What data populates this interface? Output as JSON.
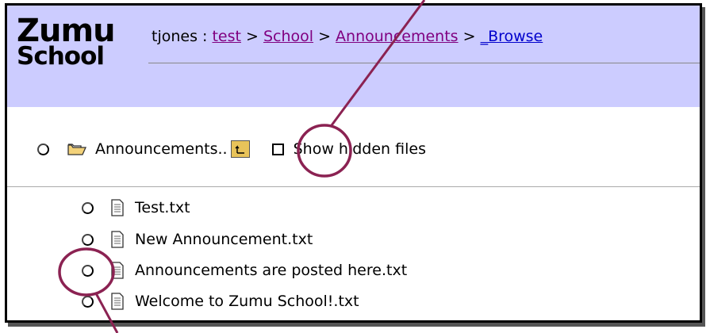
{
  "logo": {
    "line1": "Zumu",
    "line2": "School"
  },
  "breadcrumb": {
    "user": "tjones",
    "sep1": " : ",
    "items": [
      "test",
      "School",
      "Announcements",
      "_Browse"
    ],
    "sep": " > "
  },
  "folder": {
    "name": "Announcements",
    "ellipsis": " ..",
    "show_hidden_label": "Show hidden files"
  },
  "files": [
    "Test.txt",
    "New Announcement.txt",
    "Announcements are posted here.txt",
    "Welcome to Zumu School!.txt"
  ],
  "colors": {
    "header_bg": "#ccccff",
    "annotation": "#8b2252",
    "visited_link": "#800080",
    "link": "#0000cc"
  }
}
